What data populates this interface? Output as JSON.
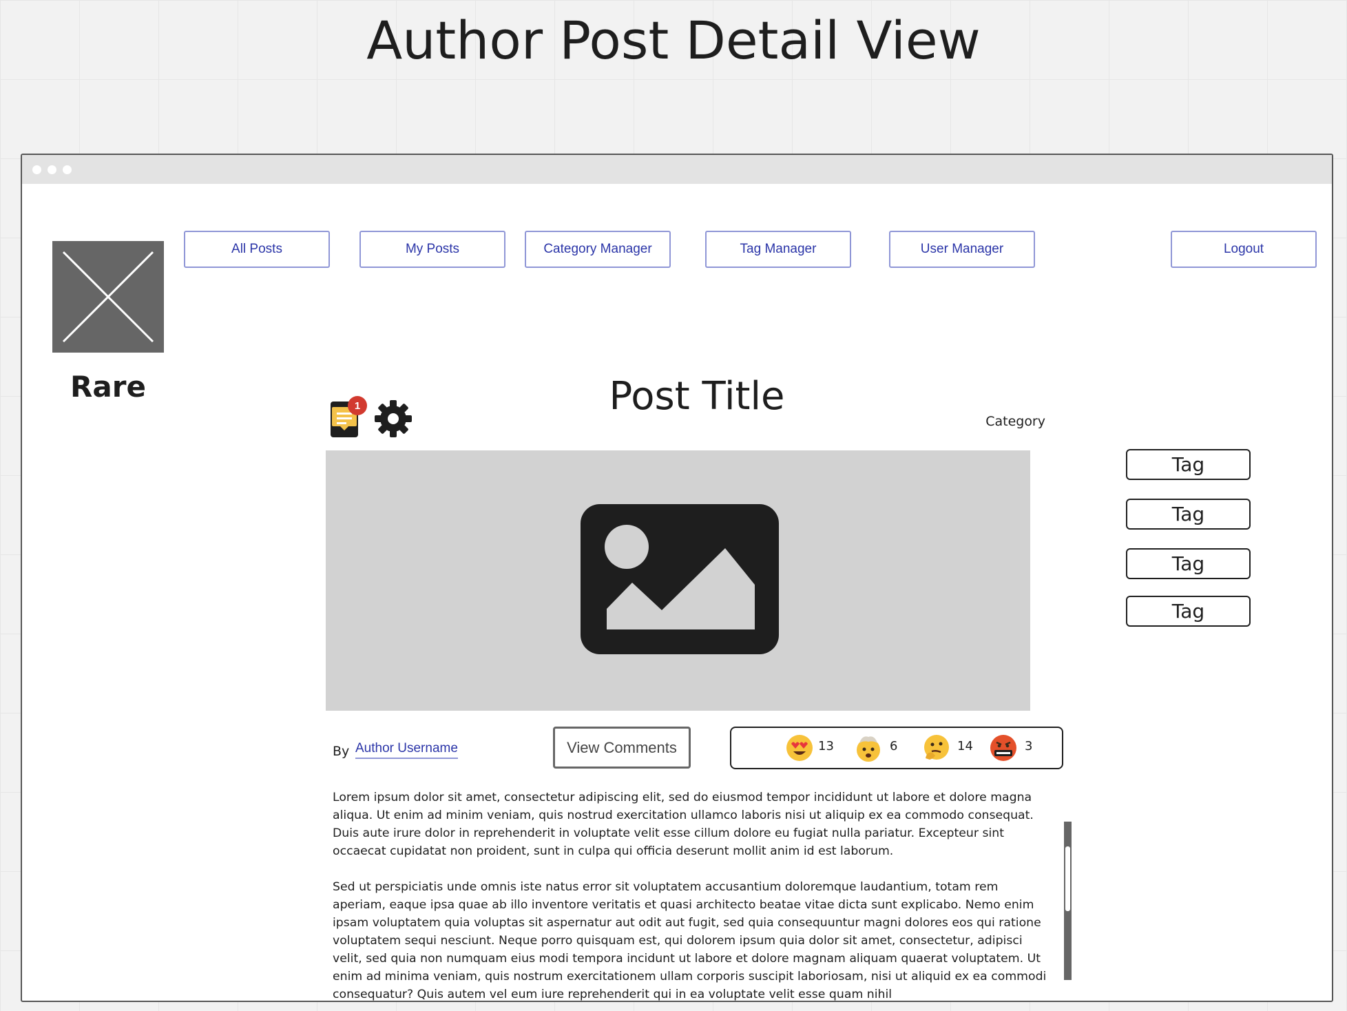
{
  "page_heading": "Author Post Detail View",
  "brand": "Rare",
  "nav": {
    "all_posts": "All Posts",
    "my_posts": "My Posts",
    "category_manager": "Category Manager",
    "tag_manager": "Tag Manager",
    "user_manager": "User Manager",
    "logout": "Logout"
  },
  "post": {
    "title": "Post Title",
    "category": "Category",
    "by_label": "By",
    "author": "Author Username",
    "notification_count": "1",
    "tags": [
      "Tag",
      "Tag",
      "Tag",
      "Tag"
    ],
    "view_comments": "View Comments",
    "paragraphs": [
      "Lorem ipsum dolor sit amet, consectetur adipiscing elit, sed do eiusmod tempor incididunt ut labore et dolore magna aliqua. Ut enim ad minim veniam, quis nostrud exercitation ullamco laboris nisi ut aliquip ex ea commodo consequat. Duis aute irure dolor in reprehenderit in voluptate velit esse cillum dolore eu fugiat nulla pariatur. Excepteur sint occaecat cupidatat non proident, sunt in culpa qui officia deserunt mollit anim id est laborum.",
      "Sed ut perspiciatis unde omnis iste natus error sit voluptatem accusantium doloremque laudantium, totam rem aperiam, eaque ipsa quae ab illo inventore veritatis et quasi architecto beatae vitae dicta sunt explicabo. Nemo enim ipsam voluptatem quia voluptas sit aspernatur aut odit aut fugit, sed quia consequuntur magni dolores eos qui ratione voluptatem sequi nesciunt. Neque porro quisquam est, qui dolorem ipsum quia dolor sit amet, consectetur, adipisci velit, sed quia non numquam eius modi tempora incidunt ut labore et dolore magnam aliquam quaerat voluptatem. Ut enim ad minima veniam, quis nostrum exercitationem ullam corporis suscipit laboriosam, nisi ut aliquid ex ea commodi consequatur? Quis autem vel eum iure reprehenderit qui in ea voluptate velit esse quam nihil"
    ]
  },
  "reactions": [
    {
      "icon": "heart-eyes-emoji-icon",
      "count": "13"
    },
    {
      "icon": "mind-blown-emoji-icon",
      "count": "6"
    },
    {
      "icon": "thinking-emoji-icon",
      "count": "14"
    },
    {
      "icon": "cursing-emoji-icon",
      "count": "3"
    }
  ],
  "colors": {
    "nav_text": "#2b35a8",
    "nav_border": "#8f96d6",
    "badge": "#d23a2f",
    "image_placeholder": "#d2d2d2"
  }
}
